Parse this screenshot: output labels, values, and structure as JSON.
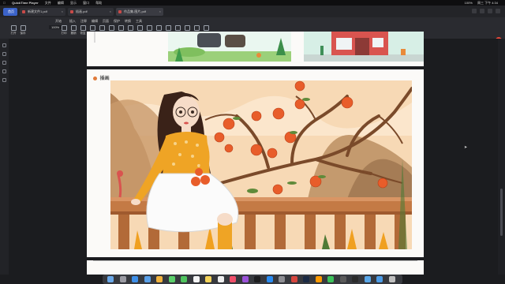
{
  "menubar": {
    "app_name": "QuickTime Player",
    "menu_items": [
      "文件",
      "编辑",
      "显示",
      "窗口",
      "帮助"
    ],
    "status_items": [
      "100%",
      "周三 下午 4:34"
    ]
  },
  "tabs": [
    {
      "label": "首页",
      "color": "#3b63c9",
      "active": true
    },
    {
      "label": "新建文件1.pdf",
      "color": "#c84a48",
      "active": false
    },
    {
      "label": "插画.pdf",
      "color": "#c84a48",
      "active": false
    },
    {
      "label": "作品集-图片.pdf",
      "color": "#c84a48",
      "active": false
    }
  ],
  "ribbon": {
    "tabs": [
      "开始",
      "插入",
      "注释",
      "编辑",
      "页面",
      "保护",
      "转换",
      "工具"
    ],
    "active_tab": "开始",
    "tools": [
      "打开",
      "保存",
      "打印",
      "撤销",
      "恢复",
      "缩放",
      "适合页面",
      "单页",
      "连续",
      "旋转",
      "查找",
      "替换",
      "书签",
      "高亮",
      "标注",
      "文本框",
      "图片",
      "签名"
    ],
    "zoom_value": "100%"
  },
  "document": {
    "section_title": "插画"
  },
  "colors": {
    "accent": "#3b63c9",
    "tab_pdf": "#c84a48",
    "page_bg": "#fbfaf8",
    "app_bg": "#1b1c1f"
  },
  "dock_icons": [
    "finder",
    "launchpad",
    "safari",
    "mail",
    "photos",
    "messages",
    "facetime",
    "calendar",
    "notes",
    "reminders",
    "music",
    "podcasts",
    "tv",
    "app-store",
    "settings",
    "pdf-reader",
    "photoshop",
    "illustrator",
    "wechat",
    "quicktime",
    "terminal",
    "folder",
    "downloads",
    "trash"
  ]
}
